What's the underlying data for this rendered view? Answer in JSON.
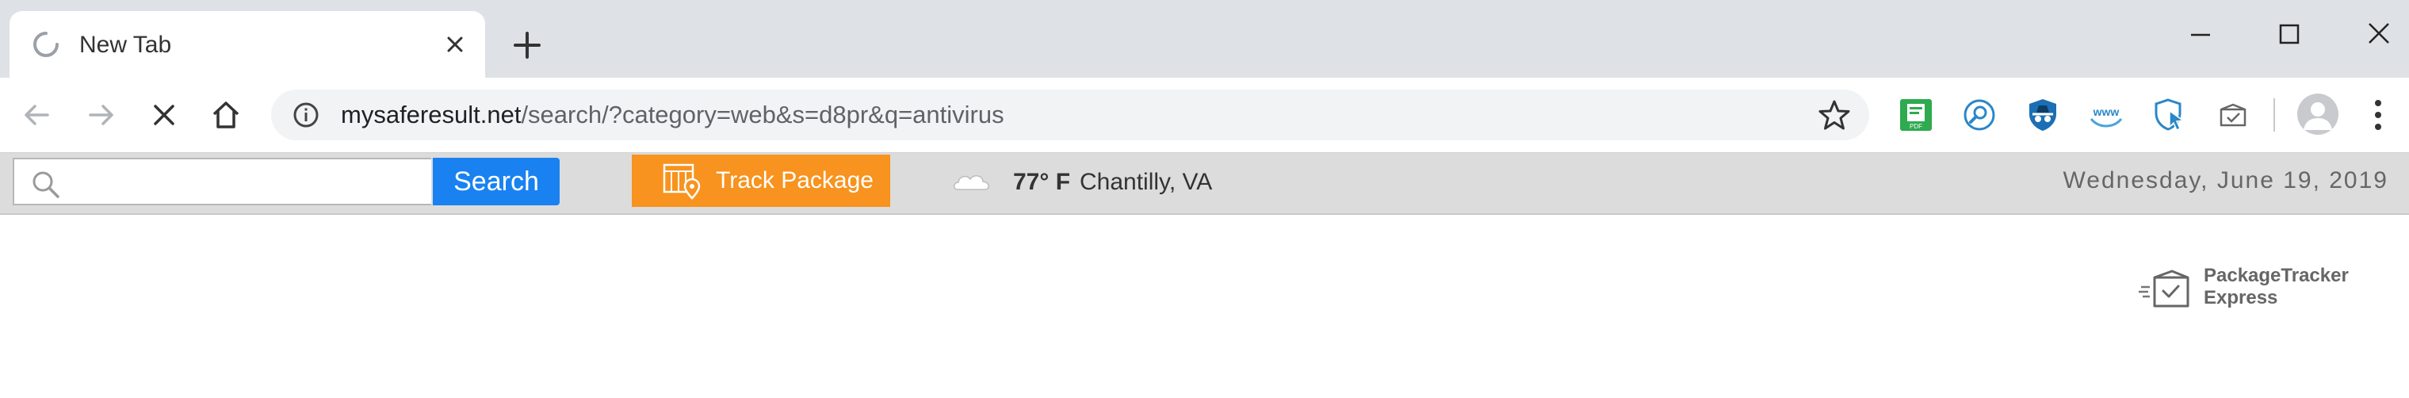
{
  "browser": {
    "tab": {
      "title": "New Tab",
      "loading_icon": "spinner-icon",
      "close_icon": "close-icon"
    },
    "new_tab_icon": "plus-icon",
    "window_controls": [
      "minimize-icon",
      "maximize-icon",
      "close-icon"
    ],
    "nav": {
      "back_icon": "arrow-left-icon",
      "forward_icon": "arrow-right-icon",
      "stop_icon": "stop-icon",
      "home_icon": "home-icon"
    },
    "url": {
      "host": "mysaferesult.net",
      "path": "/search/?category=web&s=d8pr&q=antivirus"
    },
    "extensions": [
      "pdf-extension-icon",
      "search-extension-icon",
      "spy-shield-extension-icon",
      "www-extension-icon",
      "shield-cursor-extension-icon",
      "package-extension-icon"
    ]
  },
  "sitebar": {
    "search": {
      "value": "",
      "placeholder": "",
      "button_label": "Search"
    },
    "track_label": "Track Package",
    "weather": {
      "temp": "77° F",
      "city": "Chantilly, VA",
      "icon": "cloud-icon"
    },
    "date": "Wednesday, June 19, 2019"
  },
  "logo": {
    "line1": "PackageTracker",
    "line2": "Express"
  },
  "colors": {
    "search_button": "#1a82f0",
    "track_button": "#f7931e",
    "titlebar": "#dee1e6",
    "sitebar": "#dcdcdc"
  }
}
